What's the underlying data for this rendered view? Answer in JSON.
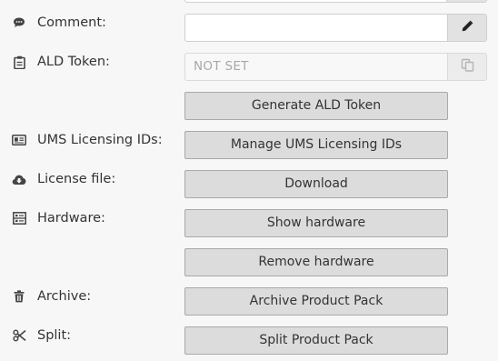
{
  "form": {
    "comment": {
      "label": "Comment:",
      "icon": "comment-icon",
      "value": "",
      "edit_icon": "pencil-icon"
    },
    "ald_token": {
      "label": "ALD Token:",
      "icon": "clipboard-icon",
      "value": "NOT SET",
      "copy_icon": "copy-icon",
      "generate_button": "Generate ALD Token"
    },
    "ums_licensing_ids": {
      "label": "UMS Licensing IDs:",
      "icon": "id-card-icon",
      "button": "Manage UMS Licensing IDs"
    },
    "license_file": {
      "label": "License file:",
      "icon": "cloud-download-icon",
      "button": "Download"
    },
    "hardware": {
      "label": "Hardware:",
      "icon": "hardware-list-icon",
      "show_button": "Show hardware",
      "remove_button": "Remove hardware"
    },
    "archive": {
      "label": "Archive:",
      "icon": "trash-icon",
      "button": "Archive Product Pack"
    },
    "split": {
      "label": "Split:",
      "icon": "scissors-icon",
      "button": "Split Product Pack"
    }
  },
  "colors": {
    "background": "#f7f7f7",
    "button_bg": "#dcdcdc",
    "button_border": "#a9a9a9",
    "field_border": "#cfcfcf",
    "addon_bg": "#e2e2e2",
    "text": "#333333",
    "placeholder_text": "#a8a8a8"
  }
}
